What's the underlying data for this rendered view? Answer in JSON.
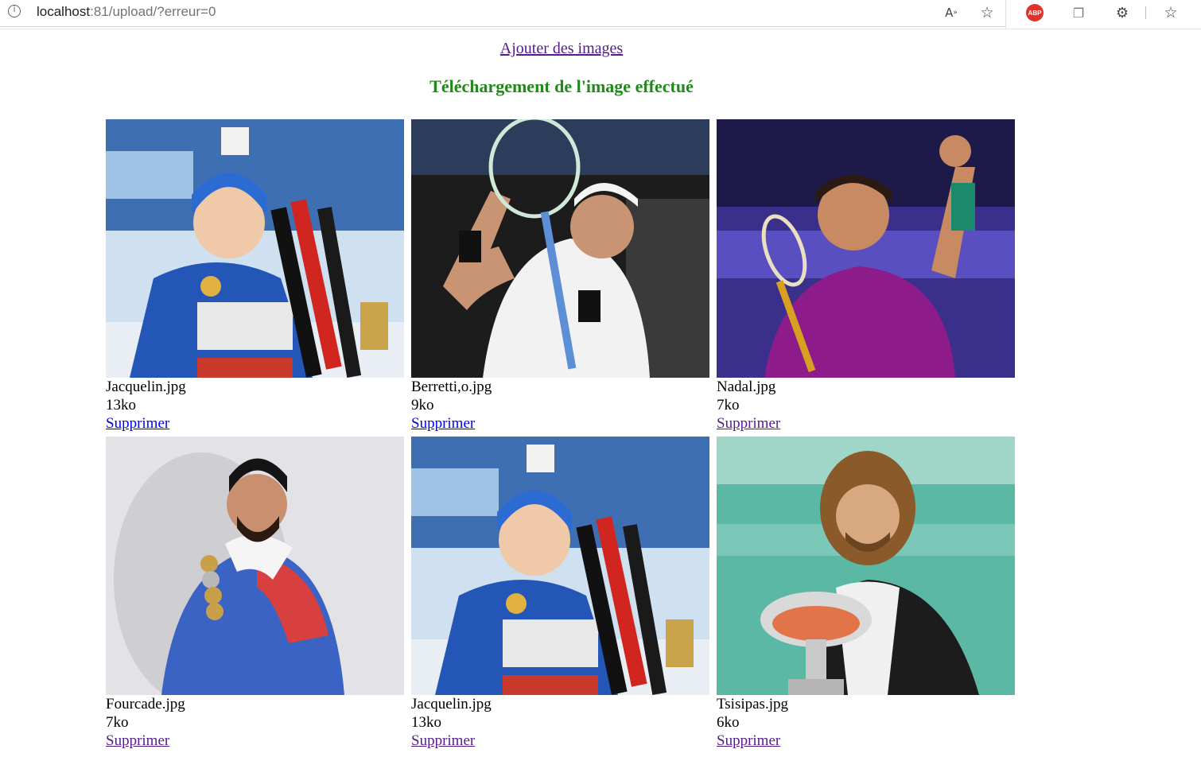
{
  "browser": {
    "url_host": "localhost",
    "url_rest": ":81/upload/?erreur=0",
    "abp_label": "ABP"
  },
  "page": {
    "add_link": "Ajouter des images",
    "success_message": "Téléchargement de l'image effectué",
    "delete_label": "Supprimer"
  },
  "images": [
    {
      "filename": "Jacquelin.jpg",
      "size": "13ko",
      "subject": "biathlete-with-medal"
    },
    {
      "filename": "Berretti,o.jpg",
      "size": "9ko",
      "subject": "tennis-player-with-racket"
    },
    {
      "filename": "Nadal.jpg",
      "size": "7ko",
      "subject": "tennis-player-celebrating"
    },
    {
      "filename": "Fourcade.jpg",
      "size": "7ko",
      "subject": "biathlete-with-medals"
    },
    {
      "filename": "Jacquelin.jpg",
      "size": "13ko",
      "subject": "biathlete-with-medal"
    },
    {
      "filename": "Tsisipas.jpg",
      "size": "6ko",
      "subject": "tennis-player-with-trophy"
    }
  ],
  "colors": {
    "success": "#21891a",
    "visited_link": "#551a8b",
    "unvisited_link": "#0000ee"
  }
}
